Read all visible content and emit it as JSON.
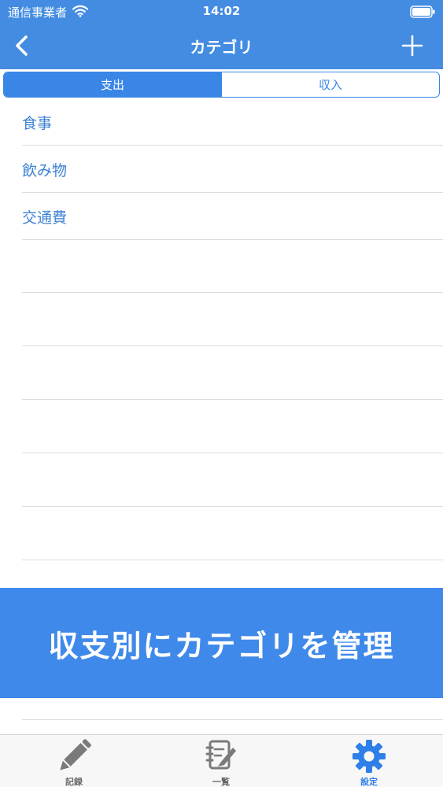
{
  "status_bar": {
    "carrier": "通信事業者",
    "time": "14:02"
  },
  "nav": {
    "title": "カテゴリ",
    "back_icon": "chevron-left-icon",
    "add_icon": "plus-icon"
  },
  "segments": [
    {
      "label": "支出",
      "selected": true
    },
    {
      "label": "収入",
      "selected": false
    }
  ],
  "categories": [
    {
      "label": "食事"
    },
    {
      "label": "飲み物"
    },
    {
      "label": "交通費"
    }
  ],
  "banner": {
    "text": "収支別にカテゴリを管理"
  },
  "tabs": [
    {
      "label": "記録",
      "icon": "pencil-icon",
      "selected": false
    },
    {
      "label": "一覧",
      "icon": "notebook-edit-icon",
      "selected": false
    },
    {
      "label": "設定",
      "icon": "gear-icon",
      "selected": true
    }
  ],
  "colors": {
    "header": "#438ce2",
    "accent": "#3a86e6",
    "list_text": "#3d82d4",
    "banner": "#3f89ea",
    "tab_inactive": "#7a7a7a",
    "tab_active": "#2f7fe9"
  }
}
